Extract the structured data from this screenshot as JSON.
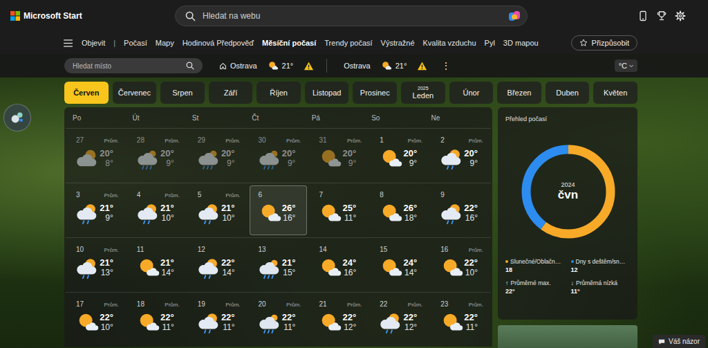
{
  "header": {
    "logo": "Microsoft Start",
    "search": {
      "placeholder": "Hledat na webu"
    }
  },
  "nav": {
    "items": [
      {
        "label": "Objevit",
        "selected": false
      },
      {
        "label": "Počasí",
        "selected": false
      },
      {
        "label": "Mapy",
        "selected": false
      },
      {
        "label": "Hodinová Předpověď",
        "selected": false
      },
      {
        "label": "Měsíční počasí",
        "selected": true
      },
      {
        "label": "Trendy počasí",
        "selected": false
      },
      {
        "label": "Výstražné",
        "selected": false
      },
      {
        "label": "Kvalita vzduchu",
        "selected": false
      },
      {
        "label": "Pyl",
        "selected": false
      },
      {
        "label": "3D mapou",
        "selected": false
      }
    ],
    "separator": "|",
    "customize": "Přizpůsobit"
  },
  "location_bar": {
    "search": {
      "placeholder": "Hledat místo"
    },
    "locations": [
      {
        "name": "Ostrava",
        "temp": "21°",
        "home": true,
        "alert": true
      },
      {
        "name": "Ostrava",
        "temp": "21°",
        "home": false,
        "alert": true
      }
    ],
    "more": "⋮",
    "unit": "°C"
  },
  "months": [
    {
      "label": "Červen",
      "selected": true
    },
    {
      "label": "Červenec",
      "selected": false
    },
    {
      "label": "Srpen",
      "selected": false
    },
    {
      "label": "Září",
      "selected": false
    },
    {
      "label": "Říjen",
      "selected": false
    },
    {
      "label": "Listopad",
      "selected": false
    },
    {
      "label": "Prosinec",
      "selected": false
    },
    {
      "label": "Leden",
      "year": "2025",
      "selected": false
    },
    {
      "label": "Únor",
      "selected": false
    },
    {
      "label": "Březen",
      "selected": false
    },
    {
      "label": "Duben",
      "selected": false
    },
    {
      "label": "Květen",
      "selected": false
    }
  ],
  "calendar": {
    "weekdays": [
      "Po",
      "Út",
      "St",
      "Čt",
      "Pá",
      "So",
      "Ne"
    ],
    "weeks": [
      [
        {
          "day": "27",
          "avg": "Prům.",
          "high": "20°",
          "low": "8°",
          "kind": "cloudy",
          "muted": true,
          "selected": false
        },
        {
          "day": "28",
          "avg": "Prům.",
          "high": "20°",
          "low": "9°",
          "kind": "rain",
          "muted": true,
          "selected": false
        },
        {
          "day": "29",
          "avg": "Prům.",
          "high": "20°",
          "low": "9°",
          "kind": "rain",
          "muted": true,
          "selected": false
        },
        {
          "day": "30",
          "avg": "Prům.",
          "high": "20°",
          "low": "9°",
          "kind": "rain",
          "muted": true,
          "selected": false
        },
        {
          "day": "31",
          "avg": "Prům.",
          "high": "20°",
          "low": "9°",
          "kind": "partly",
          "muted": true,
          "selected": false
        },
        {
          "day": "1",
          "avg": "Prům.",
          "high": "20°",
          "low": "9°",
          "kind": "partly",
          "muted": false,
          "selected": false
        },
        {
          "day": "2",
          "avg": "Prům.",
          "high": "20°",
          "low": "9°",
          "kind": "showers",
          "muted": false,
          "selected": false
        }
      ],
      [
        {
          "day": "3",
          "avg": "Prům.",
          "high": "21°",
          "low": "9°",
          "kind": "showers",
          "muted": false,
          "selected": false
        },
        {
          "day": "4",
          "avg": "Prům.",
          "high": "21°",
          "low": "10°",
          "kind": "showers",
          "muted": false,
          "selected": false
        },
        {
          "day": "5",
          "avg": "Prům.",
          "high": "21°",
          "low": "10°",
          "kind": "showers",
          "muted": false,
          "selected": false
        },
        {
          "day": "6",
          "high": "26°",
          "low": "16°",
          "kind": "partly",
          "muted": false,
          "selected": true
        },
        {
          "day": "7",
          "high": "25°",
          "low": "11°",
          "kind": "partly",
          "muted": false,
          "selected": false
        },
        {
          "day": "8",
          "high": "26°",
          "low": "18°",
          "kind": "partly",
          "muted": false,
          "selected": false
        },
        {
          "day": "9",
          "high": "22°",
          "low": "16°",
          "kind": "showers",
          "muted": false,
          "selected": false
        }
      ],
      [
        {
          "day": "10",
          "avg": "Prům.",
          "high": "21°",
          "low": "13°",
          "kind": "showers",
          "muted": false,
          "selected": false
        },
        {
          "day": "11",
          "high": "21°",
          "low": "14°",
          "kind": "partly",
          "muted": false,
          "selected": false
        },
        {
          "day": "12",
          "high": "22°",
          "low": "14°",
          "kind": "showers",
          "muted": false,
          "selected": false
        },
        {
          "day": "13",
          "high": "21°",
          "low": "15°",
          "kind": "rain",
          "muted": false,
          "selected": false
        },
        {
          "day": "14",
          "high": "24°",
          "low": "16°",
          "kind": "partly",
          "muted": false,
          "selected": false
        },
        {
          "day": "15",
          "high": "24°",
          "low": "14°",
          "kind": "partly",
          "muted": false,
          "selected": false
        },
        {
          "day": "16",
          "avg": "Prům.",
          "high": "22°",
          "low": "10°",
          "kind": "partly",
          "muted": false,
          "selected": false
        }
      ],
      [
        {
          "day": "17",
          "avg": "Prům.",
          "high": "22°",
          "low": "10°",
          "kind": "partly",
          "muted": false,
          "selected": false
        },
        {
          "day": "18",
          "avg": "Prům.",
          "high": "22°",
          "low": "11°",
          "kind": "partly",
          "muted": false,
          "selected": false
        },
        {
          "day": "19",
          "avg": "Prům.",
          "high": "22°",
          "low": "11°",
          "kind": "showers",
          "muted": false,
          "selected": false
        },
        {
          "day": "20",
          "avg": "Prům.",
          "high": "22°",
          "low": "11°",
          "kind": "rain",
          "muted": false,
          "selected": false
        },
        {
          "day": "21",
          "avg": "Prům.",
          "high": "22°",
          "low": "12°",
          "kind": "partly",
          "muted": false,
          "selected": false
        },
        {
          "day": "22",
          "avg": "Prům.",
          "high": "22°",
          "low": "12°",
          "kind": "showers",
          "muted": false,
          "selected": false
        },
        {
          "day": "23",
          "avg": "Prům.",
          "high": "22°",
          "low": "11°",
          "kind": "partly",
          "muted": false,
          "selected": false
        }
      ]
    ]
  },
  "overview": {
    "title": "Přehled počasí",
    "chart": {
      "year": "2024",
      "month": "čvn",
      "values": [
        18,
        12
      ]
    },
    "legend": [
      {
        "label": "Slunečné/Oblačn…",
        "value": "18",
        "color": "#f7a928"
      },
      {
        "label": "Dny s deštěm/sn…",
        "value": "12",
        "color": "#2d8cf0"
      }
    ],
    "stats": [
      {
        "arrow": "↑",
        "label": "Průměrné max.",
        "value": "22°"
      },
      {
        "arrow": "↓",
        "label": "Průměrná nízká",
        "value": "11°"
      }
    ]
  },
  "feedback": "Váš názor"
}
